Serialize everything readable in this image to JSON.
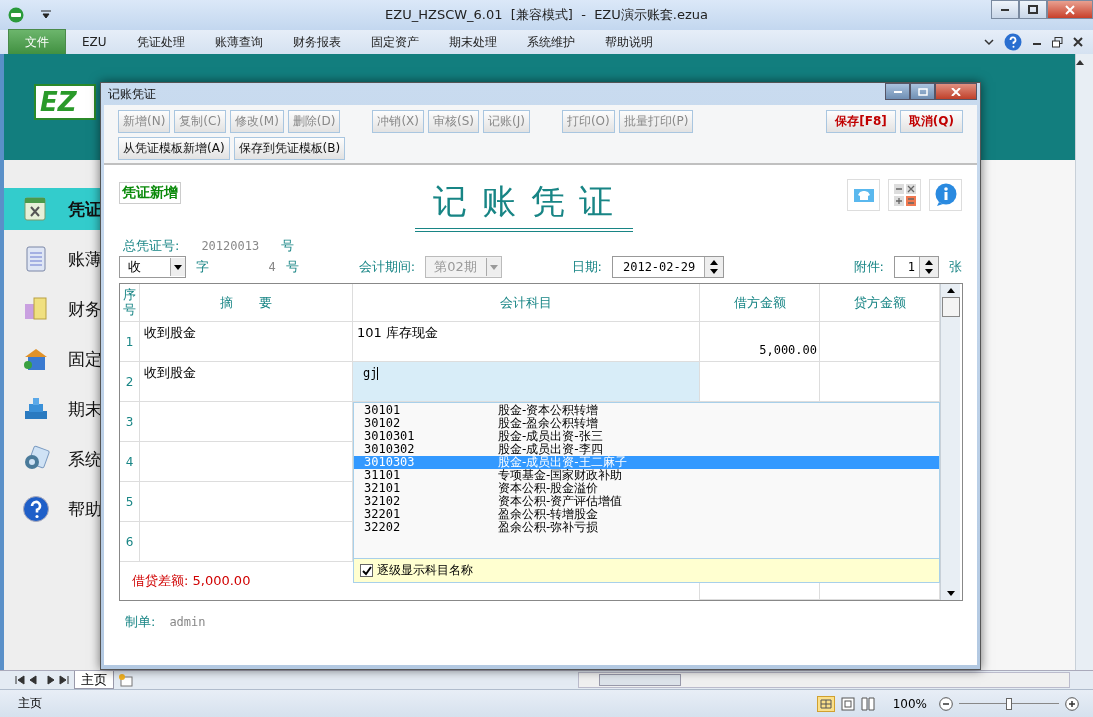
{
  "window": {
    "title": "EZU_HZSCW_6.01  [兼容模式]  -  EZU演示账套.ezua"
  },
  "menu": [
    {
      "label": "文件",
      "selected": true
    },
    {
      "label": "EZU",
      "selected": false
    },
    {
      "label": "凭证处理",
      "selected": false
    },
    {
      "label": "账薄查询",
      "selected": false
    },
    {
      "label": "财务报表",
      "selected": false
    },
    {
      "label": "固定资产",
      "selected": false
    },
    {
      "label": "期末处理",
      "selected": false
    },
    {
      "label": "系统维护",
      "selected": false
    },
    {
      "label": "帮助说明",
      "selected": false
    }
  ],
  "logo": {
    "text": "EZ"
  },
  "sidebar": [
    {
      "label": "凭证",
      "selected": true,
      "kind": "voucher"
    },
    {
      "label": "账薄",
      "selected": false,
      "kind": "ledger"
    },
    {
      "label": "财务",
      "selected": false,
      "kind": "report"
    },
    {
      "label": "固定",
      "selected": false,
      "kind": "asset"
    },
    {
      "label": "期末",
      "selected": false,
      "kind": "period"
    },
    {
      "label": "系统",
      "selected": false,
      "kind": "system"
    },
    {
      "label": "帮助",
      "selected": false,
      "kind": "help"
    }
  ],
  "dialog": {
    "title": "记账凭证",
    "toolbar": [
      {
        "groups": [
          [
            {
              "label": "新增(N)",
              "disabled": true,
              "kind": "normal"
            },
            {
              "label": "复制(C)",
              "disabled": true,
              "kind": "normal"
            },
            {
              "label": "修改(M)",
              "disabled": true,
              "kind": "normal"
            },
            {
              "label": "删除(D)",
              "disabled": true,
              "kind": "normal"
            }
          ],
          [
            {
              "label": "冲销(X)",
              "disabled": true,
              "kind": "normal"
            },
            {
              "label": "审核(S)",
              "disabled": true,
              "kind": "normal"
            },
            {
              "label": "记账(J)",
              "disabled": true,
              "kind": "normal"
            }
          ],
          [
            {
              "label": "打印(O)",
              "disabled": true,
              "kind": "normal"
            },
            {
              "label": "批量打印(P)",
              "disabled": true,
              "kind": "normal"
            }
          ],
          [
            {
              "label": "保存[F8]",
              "disabled": false,
              "kind": "primary"
            },
            {
              "label": "取消(Q)",
              "disabled": false,
              "kind": "primary"
            }
          ]
        ]
      },
      {
        "groups": [
          [
            {
              "label": "从凭证模板新增(A)",
              "disabled": false,
              "kind": "normal"
            },
            {
              "label": "保存到凭证模板(B)",
              "disabled": false,
              "kind": "normal"
            }
          ]
        ]
      }
    ],
    "status_badge": "凭证新增",
    "heading": "记 账 凭 证",
    "voucher_no": {
      "label": "总凭证号:",
      "value": "20120013",
      "unit": "号"
    },
    "voucher_type": {
      "value": "收",
      "suffix": "字",
      "number": "4",
      "unit": "号"
    },
    "period": {
      "label": "会计期间:",
      "value": "第02期",
      "disabled": true
    },
    "date": {
      "label": "日期:",
      "value": "2012-02-29"
    },
    "attachments": {
      "label": "附件:",
      "value": "1",
      "unit": "张"
    },
    "table": {
      "columns": [
        "序号",
        "摘　　要",
        "会计科目",
        "借方金额",
        "贷方金额"
      ],
      "rows": [
        {
          "no": "1",
          "summary": "收到股金",
          "account": "101  库存现金",
          "debit": "5,000.00",
          "editing": false
        },
        {
          "no": "2",
          "summary": "收到股金",
          "account": "gj",
          "editing": true
        },
        {
          "no": "3"
        },
        {
          "no": "4"
        },
        {
          "no": "5"
        },
        {
          "no": "6"
        }
      ],
      "difference": "借贷差额: 5,000.00"
    },
    "dropdown": {
      "items": [
        {
          "code": "30101",
          "name": "股金-资本公积转增",
          "selected": false
        },
        {
          "code": "30102",
          "name": "股金-盈余公积转增",
          "selected": false
        },
        {
          "code": "3010301",
          "name": "股金-成员出资-张三",
          "selected": false
        },
        {
          "code": "3010302",
          "name": "股金-成员出资-李四",
          "selected": false
        },
        {
          "code": "3010303",
          "name": "股金-成员出资-王二麻子",
          "selected": true
        },
        {
          "code": "31101",
          "name": "专项基金-国家财政补助",
          "selected": false
        },
        {
          "code": "32101",
          "name": "资本公积-股金溢价",
          "selected": false
        },
        {
          "code": "32102",
          "name": "资本公积-资产评估增值",
          "selected": false
        },
        {
          "code": "32201",
          "name": "盈余公积-转增股金",
          "selected": false
        },
        {
          "code": "32202",
          "name": "盈余公积-弥补亏损",
          "selected": false
        }
      ],
      "option": {
        "label": "逐级显示科目名称",
        "checked": true
      }
    },
    "maker": {
      "label": "制单:",
      "value": "admin"
    }
  },
  "sheet_tabs": [
    {
      "label": "主页",
      "selected": true
    }
  ],
  "status_bar": {
    "text": "主页",
    "zoom": "100%",
    "level": 0.5
  }
}
